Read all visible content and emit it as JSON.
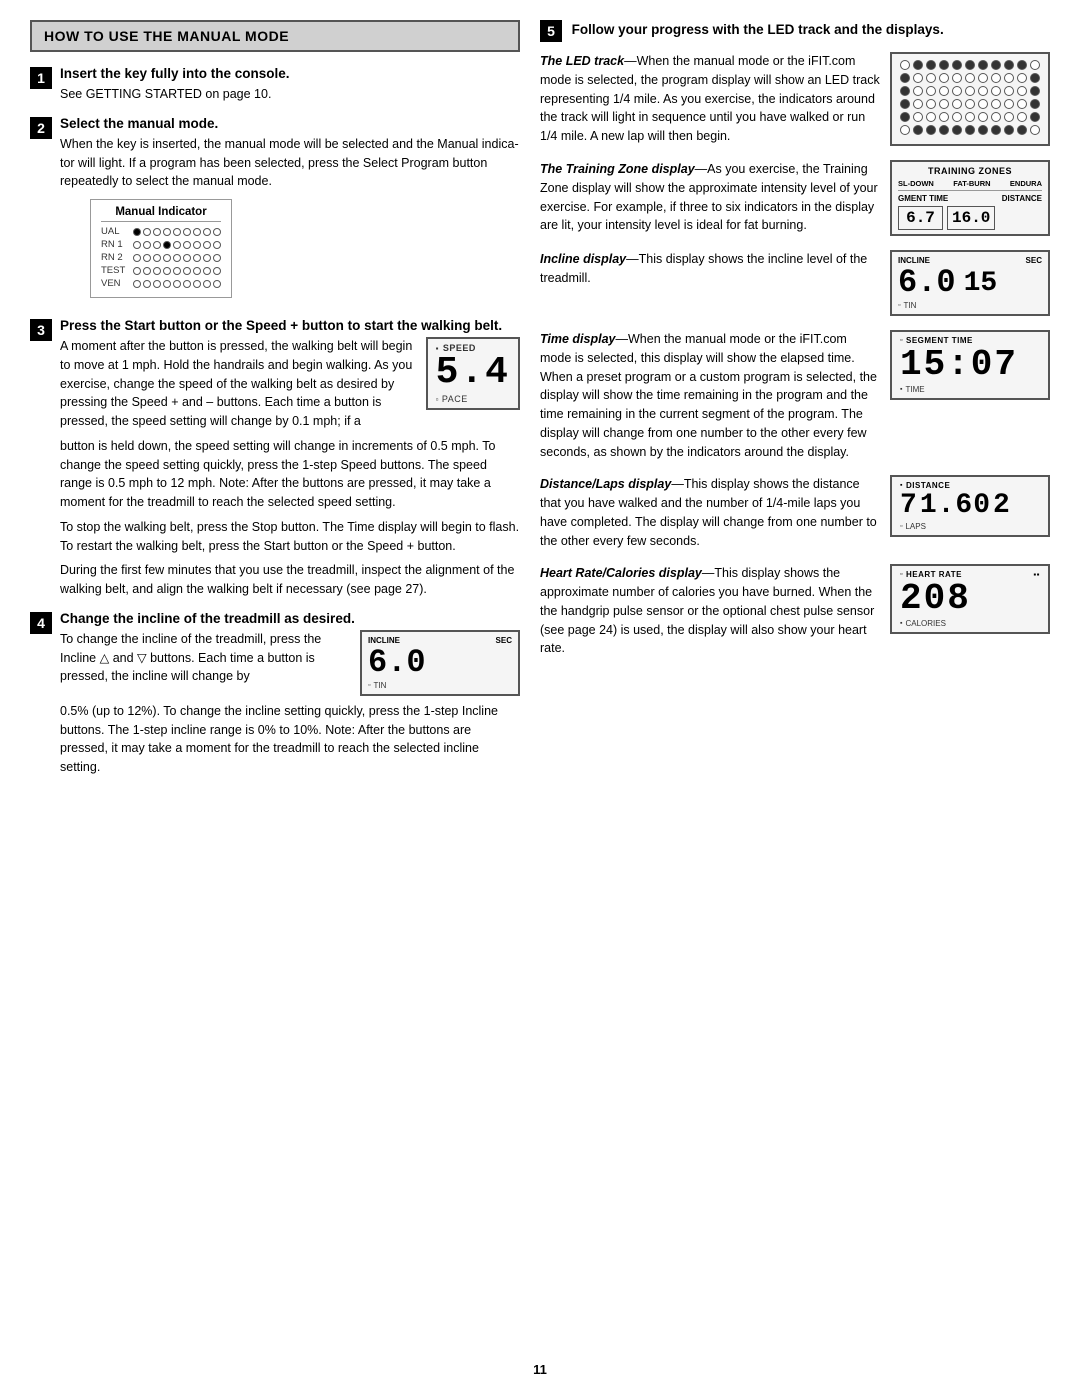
{
  "header": {
    "title": "HOW TO USE THE MANUAL MODE"
  },
  "left": {
    "step1": {
      "num": "1",
      "title": "Insert the key fully into the console.",
      "body": "See GETTING STARTED on page 10."
    },
    "step2": {
      "num": "2",
      "title": "Select the manual mode.",
      "body1": "When the key is inserted, the manual mode will be selected and the Manual indicator will light. If a program has been selected, press the Select Program button repeatedly to select the manual mode.",
      "indicator_title": "Manual Indicator",
      "indicator_rows": [
        {
          "label": "UAL",
          "dots": [
            1,
            0,
            0,
            0,
            0,
            0,
            0,
            0,
            0
          ]
        },
        {
          "label": "RN 1",
          "dots": [
            0,
            0,
            0,
            1,
            0,
            0,
            0,
            0,
            0
          ]
        },
        {
          "label": "RN 2",
          "dots": [
            0,
            0,
            0,
            0,
            0,
            0,
            0,
            0,
            0
          ]
        },
        {
          "label": "TEST",
          "dots": [
            0,
            0,
            0,
            0,
            0,
            0,
            0,
            0,
            0
          ]
        },
        {
          "label": "VEN",
          "dots": [
            0,
            0,
            0,
            0,
            0,
            0,
            0,
            0,
            0
          ]
        }
      ]
    },
    "step3": {
      "num": "3",
      "title": "Press the Start button or the Speed + button to start the walking belt.",
      "body1": "A moment after the button is pressed, the walking belt will begin to move at 1 mph. Hold the handrails and begin walking. As you exercise, change the speed of the walking belt as desired by pressing the Speed + and – buttons. Each time a button is pressed, the speed setting will change by 0.1 mph; if a button is held down, the speed setting will change in increments of 0.5 mph. To change the speed setting quickly, press the 1-step Speed buttons. The speed range is 0.5 mph to 12 mph. Note: After the buttons are pressed, it may take a moment for the treadmill to reach the selected speed setting.",
      "body2": "To stop the walking belt, press the Stop button. The Time display will begin to flash. To restart the walking belt, press the Start button or the Speed + button.",
      "body3": "During the first few minutes that you use the treadmill, inspect the alignment of the walking belt, and align the walking belt if necessary (see page 27).",
      "speed_label": "SPEED",
      "speed_value": "5.4",
      "pace_label": "PACE"
    },
    "step4": {
      "num": "4",
      "title": "Change the incline of the treadmill as desired.",
      "body1": "To change the incline of the treadmill, press the Incline △ and ▽ buttons. Each time a button is pressed, the incline will change by 0.5% (up to 12%). To change the incline setting quickly, press the 1-step Incline buttons. The 1-step incline range is 0% to 10%. Note: After the buttons are pressed, it may take a moment for the treadmill to reach the selected incline setting.",
      "incline_label": "INCLINE",
      "incline_sec_label": "SEC",
      "incline_value": "6.0",
      "time_label": "TIN"
    }
  },
  "right": {
    "step5": {
      "num": "5",
      "title": "Follow your progress with the LED track and the displays."
    },
    "led_track": {
      "label": "LED Track",
      "description_part1": "The LED track",
      "description": "—When the manual mode or the iFIT.com mode is selected, the program display will show an LED track representing 1/4 mile. As you exercise, the indicators around the track will light in sequence until you have walked or run 1/4 mile. A new lap will then begin.",
      "rows": [
        [
          0,
          1,
          1,
          1,
          1,
          1,
          1,
          1,
          1,
          1,
          0
        ],
        [
          1,
          0,
          0,
          0,
          0,
          0,
          0,
          0,
          0,
          0,
          1
        ],
        [
          1,
          0,
          0,
          0,
          0,
          0,
          0,
          0,
          0,
          0,
          1
        ],
        [
          1,
          0,
          0,
          0,
          0,
          0,
          0,
          0,
          0,
          0,
          1
        ],
        [
          1,
          0,
          0,
          0,
          0,
          0,
          0,
          0,
          0,
          0,
          1
        ],
        [
          0,
          1,
          1,
          1,
          1,
          1,
          1,
          1,
          1,
          1,
          0
        ]
      ]
    },
    "training_zones": {
      "label": "Training Zones",
      "header": "TRAINING ZONES",
      "zones": [
        "SL-DOWN",
        "FAT-BURN",
        "ENDURA"
      ],
      "segment_time_label": "SEGMENT TIME",
      "distance_label": "DISTANCE",
      "value1": "6.7",
      "value2": "16.0",
      "description_part1": "The Training Zone dis-",
      "description": "play—As you exercise, the Training Zone display will show the approximate intensity level of your exercise. For example, if three to six indicators in the display are lit, your intensity level is ideal for fat burning."
    },
    "incline_display": {
      "label": "Incline display",
      "incline_label": "INCLINE",
      "sec_label": "SEC",
      "value": "6.0",
      "right_value": "15",
      "time_label": "TIN",
      "description": "—This display shows the incline level of the treadmill."
    },
    "time_display": {
      "label": "Time display",
      "seg_time_label": "SEGMENT TIME",
      "value": "15:07",
      "time_label": "TIME",
      "description": "—When the manual mode or the iFIT.com mode is selected, this display will show the elapsed time. When a preset program or a custom program is selected, the display will show the time remaining in the program and the time remaining in the current segment of the program. The display will change from one number to the other every few seconds, as shown by the indicators around the display."
    },
    "distance_display": {
      "label": "Distance/Laps display",
      "distance_label": "DISTANCE",
      "value1": "7",
      "value2": "1.60",
      "value3": "2",
      "laps_label": "LAPS",
      "description": "—This display shows the distance that you have walked and the number of 1/4-mile laps you have completed. The display will change from one number to the other every few seconds."
    },
    "hr_display": {
      "label": "Heart Rate/Calories display",
      "hr_label": "HEART RATE",
      "value": "208",
      "calories_label": "CALORIES",
      "description": "—This display shows the approximate number of calories you have burned. When the the handgrip pulse sensor or the optional chest pulse sensor (see page 24) is used, the display will also show your heart rate."
    }
  },
  "page_number": "11"
}
